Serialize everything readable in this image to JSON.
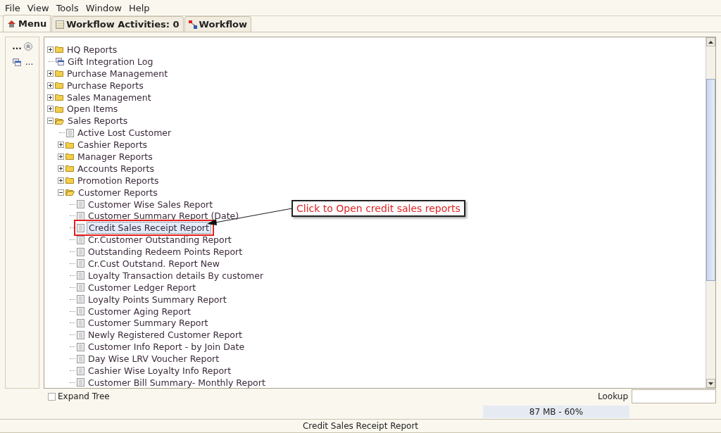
{
  "menu_bar": [
    "File",
    "View",
    "Tools",
    "Window",
    "Help"
  ],
  "tabs": [
    {
      "label": "Menu",
      "kind": "home",
      "selected": true
    },
    {
      "label": "Workflow Activities: 0",
      "kind": "table",
      "selected": false
    },
    {
      "label": "Workflow",
      "kind": "flow",
      "selected": false
    }
  ],
  "side_panel": {
    "items": [
      {
        "label": "...",
        "kind": "collapse"
      },
      {
        "label": "...",
        "kind": "window"
      }
    ]
  },
  "tree": [
    {
      "label": "HQ Reports",
      "kind": "folder",
      "expanded": false,
      "selected": false
    },
    {
      "label": "Gift Integration Log",
      "kind": "window",
      "selected": false
    },
    {
      "label": "Purchase Management",
      "kind": "folder",
      "expanded": false,
      "selected": false
    },
    {
      "label": "Purchase Reports",
      "kind": "folder",
      "expanded": false,
      "selected": false
    },
    {
      "label": "Sales Management",
      "kind": "folder",
      "expanded": false,
      "selected": false
    },
    {
      "label": "Open Items",
      "kind": "folder",
      "expanded": false,
      "selected": false
    },
    {
      "label": "Sales Reports",
      "kind": "folder",
      "expanded": true,
      "selected": false,
      "children": [
        {
          "label": "Active Lost Customer",
          "kind": "report",
          "selected": false
        },
        {
          "label": "Cashier Reports",
          "kind": "folder",
          "expanded": false,
          "selected": false
        },
        {
          "label": "Manager Reports",
          "kind": "folder",
          "expanded": false,
          "selected": false
        },
        {
          "label": "Accounts Reports",
          "kind": "folder",
          "expanded": false,
          "selected": false
        },
        {
          "label": "Promotion Reports",
          "kind": "folder",
          "expanded": false,
          "selected": false
        },
        {
          "label": "Customer Reports",
          "kind": "folder",
          "expanded": true,
          "selected": false,
          "children": [
            {
              "label": "Customer Wise Sales Report",
              "kind": "report",
              "selected": false
            },
            {
              "label": "Customer Summary Report (Date)",
              "kind": "report",
              "selected": false
            },
            {
              "label": "Credit Sales Receipt Report",
              "kind": "report",
              "selected": true
            },
            {
              "label": "Cr.Customer Outstanding Report",
              "kind": "report",
              "selected": false
            },
            {
              "label": "Outstanding Redeem Points Report",
              "kind": "report",
              "selected": false
            },
            {
              "label": "Cr.Cust Outstand. Report New",
              "kind": "report",
              "selected": false
            },
            {
              "label": "Loyalty Transaction details By customer",
              "kind": "report",
              "selected": false
            },
            {
              "label": "Customer Ledger Report",
              "kind": "report",
              "selected": false
            },
            {
              "label": "Loyalty Points Summary Report",
              "kind": "report",
              "selected": false
            },
            {
              "label": "Customer Aging Report",
              "kind": "report",
              "selected": false
            },
            {
              "label": "Customer Summary Report",
              "kind": "report",
              "selected": false
            },
            {
              "label": "Newly Registered Customer Report",
              "kind": "report",
              "selected": false
            },
            {
              "label": "Customer Info Report - by Join Date",
              "kind": "report",
              "selected": false
            },
            {
              "label": "Day Wise LRV Voucher Report",
              "kind": "report",
              "selected": false
            },
            {
              "label": "Cashier Wise Loyalty Info Report",
              "kind": "report",
              "selected": false
            },
            {
              "label": "Customer Bill Summary- Monthly Report",
              "kind": "report",
              "selected": false
            }
          ]
        }
      ]
    }
  ],
  "callout": {
    "text": "Click to Open credit sales reports"
  },
  "expand_tree": {
    "label": "Expand Tree",
    "checked": false
  },
  "lookup": {
    "label": "Lookup"
  },
  "memory": {
    "text": "87 MB - 60%"
  },
  "status_bar": "Credit Sales Receipt Report"
}
